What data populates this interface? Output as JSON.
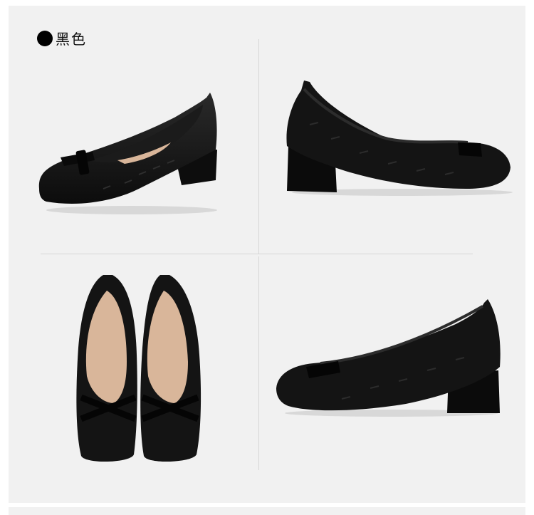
{
  "color_option": {
    "label": "黑色",
    "swatch_color": "#000000"
  },
  "product_views": [
    {
      "name": "shoe-angle-left"
    },
    {
      "name": "shoe-side-right"
    },
    {
      "name": "shoe-pair-top"
    },
    {
      "name": "shoe-angle-right"
    }
  ],
  "colors": {
    "panel_background": "#f1f1f1",
    "shoe_leather": "#141414",
    "insole": "#d9b69a",
    "divider": "#d6d6d6"
  }
}
